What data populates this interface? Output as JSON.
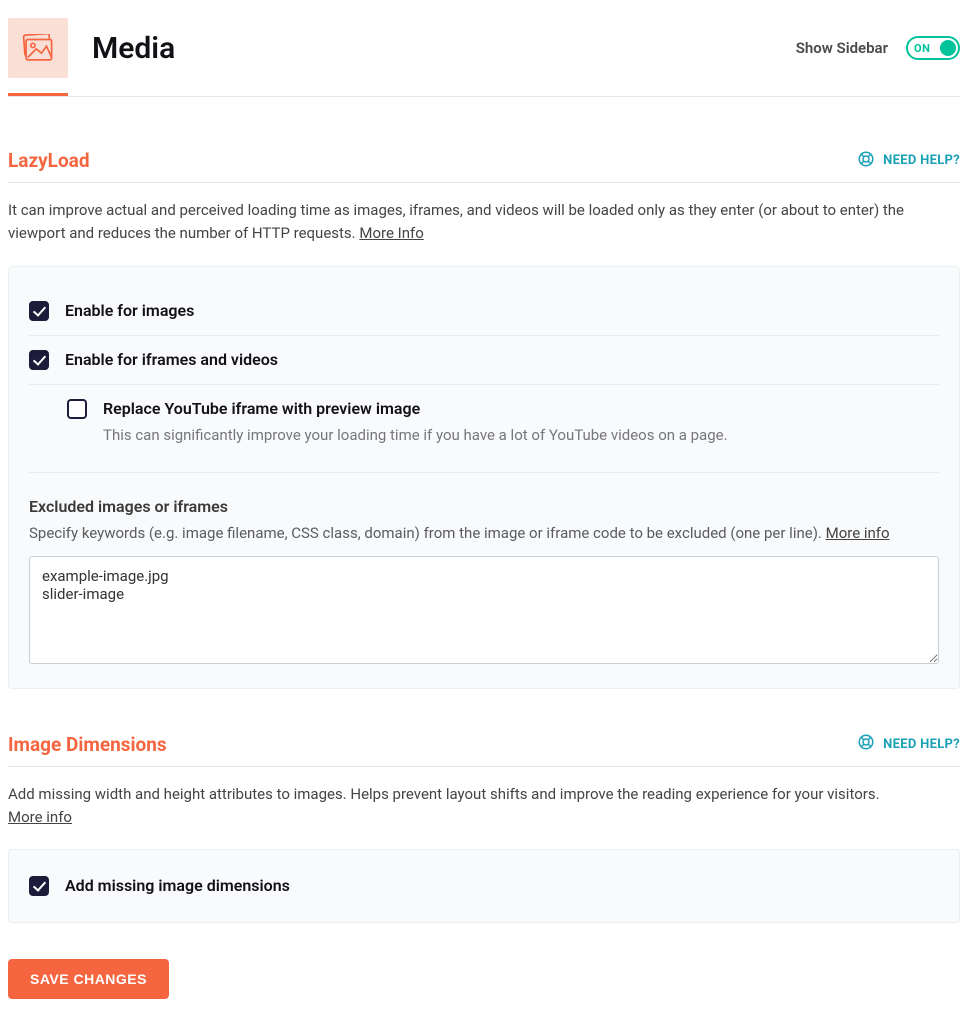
{
  "header": {
    "title": "Media",
    "sidebar_label": "Show Sidebar",
    "toggle_state": "ON"
  },
  "help_label": "NEED HELP?",
  "more_info": "More Info",
  "more_info_lc": "More info",
  "sections": {
    "lazyload": {
      "title": "LazyLoad",
      "desc": "It can improve actual and perceived loading time as images, iframes, and videos will be loaded only as they enter (or about to enter) the viewport and reduces the number of HTTP requests. ",
      "opt_images": "Enable for images",
      "opt_iframes": "Enable for iframes and videos",
      "opt_youtube": "Replace YouTube iframe with preview image",
      "opt_youtube_help": "This can significantly improve your loading time if you have a lot of YouTube videos on a page.",
      "excluded_label": "Excluded images or iframes",
      "excluded_desc": "Specify keywords (e.g. image filename, CSS class, domain) from the image or iframe code to be excluded (one per line). ",
      "excluded_value": "example-image.jpg\nslider-image"
    },
    "dimensions": {
      "title": "Image Dimensions",
      "desc": "Add missing width and height attributes to images. Helps prevent layout shifts and improve the reading experience for your visitors. ",
      "opt_missing": "Add missing image dimensions"
    }
  },
  "save_button": "SAVE CHANGES"
}
